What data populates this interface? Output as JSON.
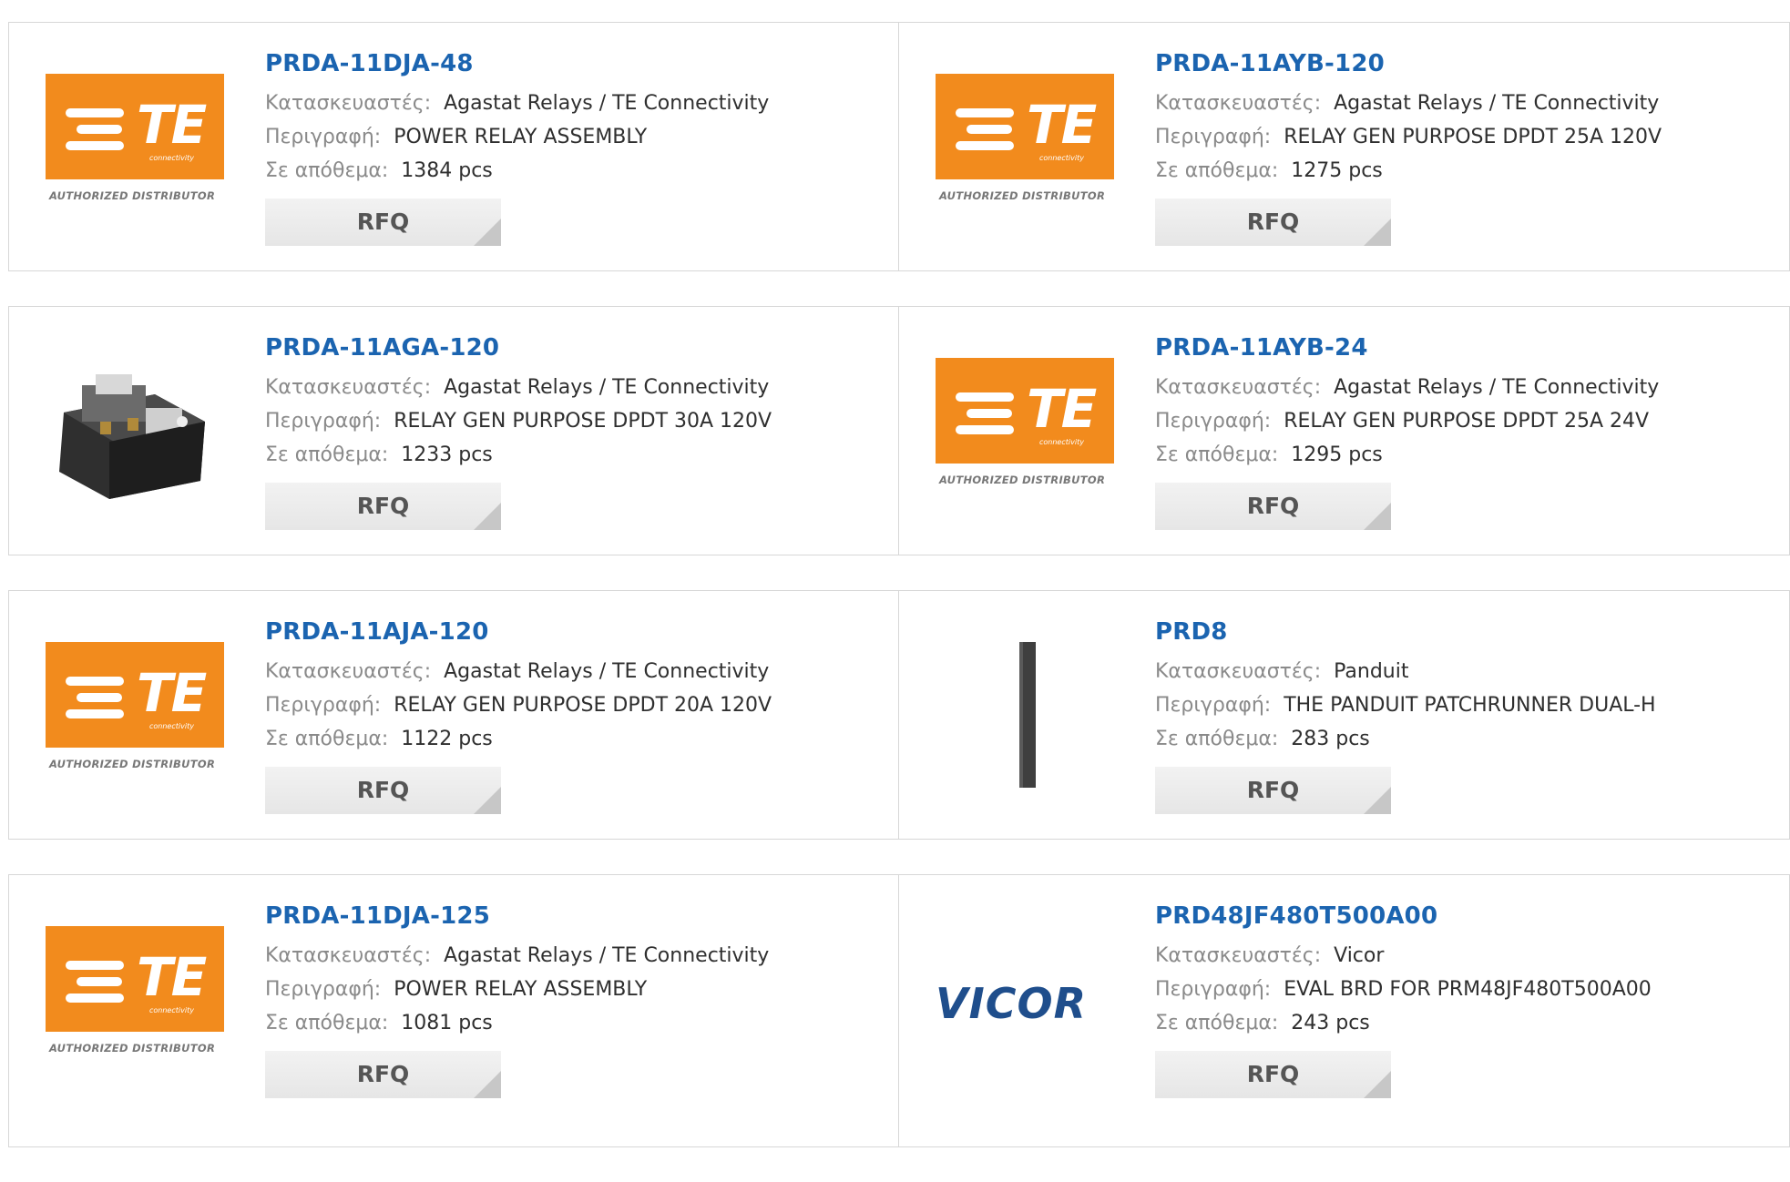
{
  "labels": {
    "manufacturer": "Κατασκευαστές:",
    "description": "Περιγραφή:",
    "stock": "Σε απόθεμα:",
    "rfq": "RFQ"
  },
  "te_logo": {
    "mark": "TE",
    "sub": "connectivity",
    "tag": "AUTHORIZED DISTRIBUTOR"
  },
  "vicor_logo": {
    "text": "VICOR"
  },
  "products": [
    {
      "part": "PRDA-11DJA-48",
      "manufacturer": "Agastat Relays / TE Connectivity",
      "description": "POWER RELAY ASSEMBLY",
      "stock": "1384 pcs",
      "logo": "te-logo"
    },
    {
      "part": "PRDA-11AYB-120",
      "manufacturer": "Agastat Relays / TE Connectivity",
      "description": "RELAY GEN PURPOSE DPDT 25A 120V",
      "stock": "1275 pcs",
      "logo": "te-logo"
    },
    {
      "part": "PRDA-11AGA-120",
      "manufacturer": "Agastat Relays / TE Connectivity",
      "description": "RELAY GEN PURPOSE DPDT 30A 120V",
      "stock": "1233 pcs",
      "logo": "relay-photo"
    },
    {
      "part": "PRDA-11AYB-24",
      "manufacturer": "Agastat Relays / TE Connectivity",
      "description": "RELAY GEN PURPOSE DPDT 25A 24V",
      "stock": "1295 pcs",
      "logo": "te-logo"
    },
    {
      "part": "PRDA-11AJA-120",
      "manufacturer": "Agastat Relays / TE Connectivity",
      "description": "RELAY GEN PURPOSE DPDT 20A 120V",
      "stock": "1122 pcs",
      "logo": "te-logo"
    },
    {
      "part": "PRD8",
      "manufacturer": "Panduit",
      "description": "THE PANDUIT PATCHRUNNER DUAL-H",
      "stock": "283 pcs",
      "logo": "patchrunner-photo"
    },
    {
      "part": "PRDA-11DJA-125",
      "manufacturer": "Agastat Relays / TE Connectivity",
      "description": "POWER RELAY ASSEMBLY",
      "stock": "1081 pcs",
      "logo": "te-logo"
    },
    {
      "part": "PRD48JF480T500A00",
      "manufacturer": "Vicor",
      "description": "EVAL BRD FOR PRM48JF480T500A00",
      "stock": "243 pcs",
      "logo": "vicor-logo"
    }
  ],
  "colors": {
    "accent": "#1b64b0",
    "te_orange": "#f28b1d",
    "vicor_blue": "#1f4e8c"
  }
}
